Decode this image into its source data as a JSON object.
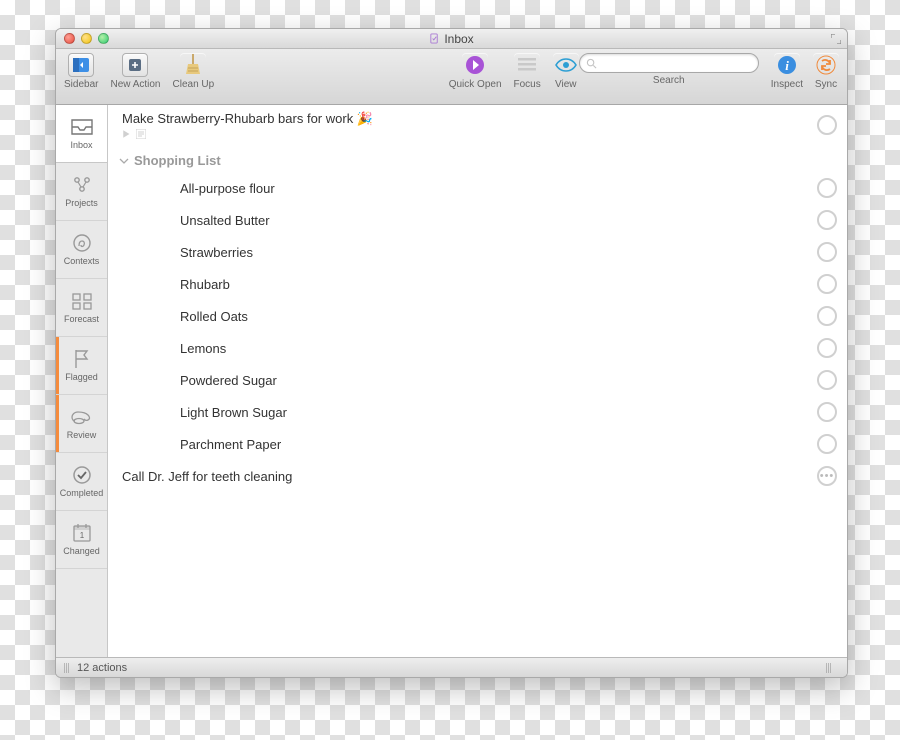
{
  "window": {
    "title": "Inbox"
  },
  "toolbar": {
    "sidebar": "Sidebar",
    "new_action": "New Action",
    "clean_up": "Clean Up",
    "quick_open": "Quick Open",
    "focus": "Focus",
    "view": "View",
    "search": "Search",
    "search_placeholder": "",
    "inspect": "Inspect",
    "sync": "Sync"
  },
  "sidebar": {
    "items": [
      {
        "label": "Inbox"
      },
      {
        "label": "Projects"
      },
      {
        "label": "Contexts"
      },
      {
        "label": "Forecast"
      },
      {
        "label": "Flagged"
      },
      {
        "label": "Review"
      },
      {
        "label": "Completed"
      },
      {
        "label": "Changed"
      }
    ]
  },
  "list": {
    "task0": {
      "title": "Make Strawberry-Rhubarb bars for work 🎉"
    },
    "group0": {
      "title": "Shopping List"
    },
    "items": [
      {
        "title": "All-purpose flour"
      },
      {
        "title": "Unsalted Butter"
      },
      {
        "title": "Strawberries"
      },
      {
        "title": "Rhubarb"
      },
      {
        "title": "Rolled Oats"
      },
      {
        "title": "Lemons"
      },
      {
        "title": "Powdered Sugar"
      },
      {
        "title": "Light Brown Sugar"
      },
      {
        "title": "Parchment Paper"
      }
    ],
    "task_last": {
      "title": "Call Dr. Jeff for teeth cleaning"
    }
  },
  "status": {
    "count": "12 actions"
  }
}
